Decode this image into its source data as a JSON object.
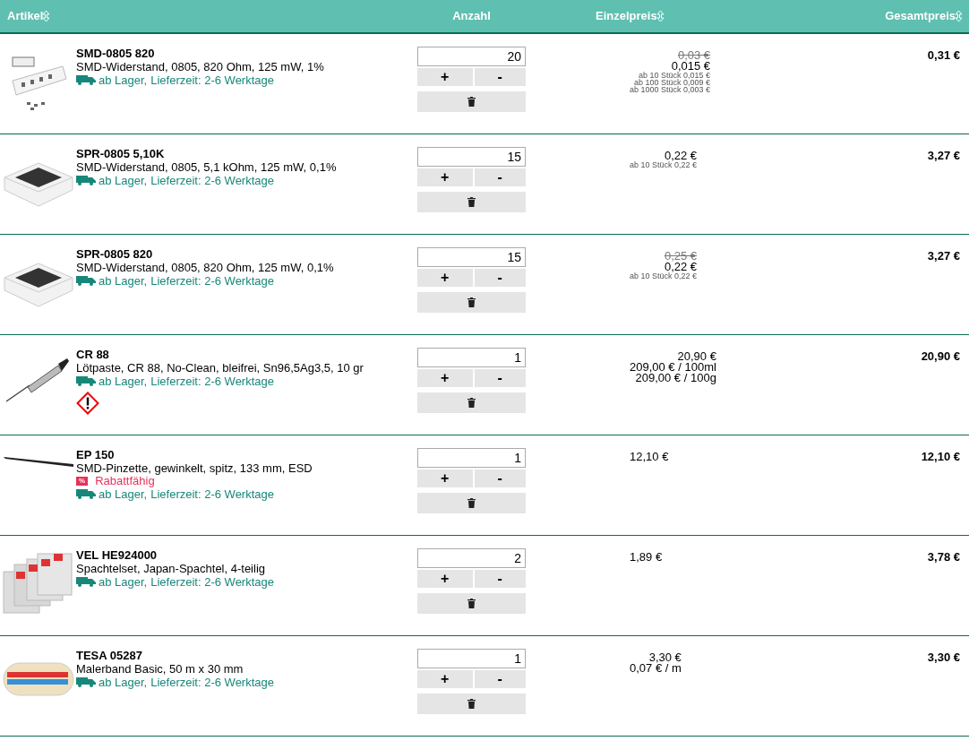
{
  "header": [
    {
      "label": "Artikel",
      "sortable": true
    },
    {
      "label": "Anzahl",
      "sortable": false
    },
    {
      "label": "Einzelpreis",
      "sortable": true
    },
    {
      "label": "Gesamtpreis",
      "sortable": true
    }
  ],
  "rows": [
    {
      "code": "SMD-0805 820",
      "description": "SMD-Widerstand, 0805, 820 Ohm, 125 mW, 1%",
      "hazard": false,
      "discount": null,
      "stock": "ab Lager,",
      "delivery": "Lieferzeit: 2-6 Werktage",
      "quantity": "20",
      "plus": "+",
      "minus": "-",
      "prices": [
        {
          "kind": "old",
          "text": "0,03 €"
        },
        {
          "kind": "main",
          "text": "0,015 €"
        },
        {
          "kind": "tier",
          "text": "ab 10 Stück 0,015 €"
        },
        {
          "kind": "tier",
          "text": "ab 100 Stück 0,009 €"
        },
        {
          "kind": "tier",
          "text": "ab 1000 Stück 0,003 €"
        }
      ],
      "total": "0,31 €"
    },
    {
      "code": "SPR-0805 5,10K",
      "description": "SMD-Widerstand, 0805, 5,1 kOhm, 125 mW, 0,1%",
      "hazard": false,
      "discount": null,
      "stock": "ab Lager,",
      "delivery": "Lieferzeit: 2-6 Werktage",
      "quantity": "15",
      "plus": "+",
      "minus": "-",
      "prices": [
        {
          "kind": "main",
          "text": "0,22 €"
        },
        {
          "kind": "tier",
          "text": "ab 10 Stück 0,22 €"
        }
      ],
      "total": "3,27 €"
    },
    {
      "code": "SPR-0805 820",
      "description": "SMD-Widerstand, 0805, 820 Ohm, 125 mW, 0,1%",
      "hazard": false,
      "discount": null,
      "stock": "ab Lager,",
      "delivery": "Lieferzeit: 2-6 Werktage",
      "quantity": "15",
      "plus": "+",
      "minus": "-",
      "prices": [
        {
          "kind": "old",
          "text": "0,25 €"
        },
        {
          "kind": "main",
          "text": "0,22 €"
        },
        {
          "kind": "tier",
          "text": "ab 10 Stück 0,22 €"
        }
      ],
      "total": "3,27 €"
    },
    {
      "code": "CR 88",
      "description": "Lötpaste, CR 88, No-Clean, bleifrei, Sn96,5Ag3,5, 10 gr",
      "hazard": true,
      "discount": null,
      "stock": "ab Lager,",
      "delivery": "Lieferzeit: 2-6 Werktage",
      "quantity": "1",
      "plus": "+",
      "minus": "-",
      "prices": [
        {
          "kind": "main",
          "text": "20,90 €"
        },
        {
          "kind": "main",
          "text": "209,00 € / 100ml"
        },
        {
          "kind": "main",
          "text": "209,00 € / 100g"
        }
      ],
      "total": "20,90 €"
    },
    {
      "code": "EP 150",
      "description": "SMD-Pinzette, gewinkelt, spitz, 133 mm, ESD",
      "hazard": false,
      "discount": {
        "icon": "%",
        "label": "Rabattfähig"
      },
      "stock": "ab Lager,",
      "delivery": "Lieferzeit: 2-6 Werktage",
      "quantity": "1",
      "plus": "+",
      "minus": "-",
      "prices": [
        {
          "kind": "main",
          "text": "12,10 €"
        }
      ],
      "total": "12,10 €"
    },
    {
      "code": "VEL HE924000",
      "description": "Spachtelset, Japan-Spachtel, 4-teilig",
      "hazard": false,
      "discount": null,
      "stock": "ab Lager,",
      "delivery": "Lieferzeit: 2-6 Werktage",
      "quantity": "2",
      "plus": "+",
      "minus": "-",
      "prices": [
        {
          "kind": "main",
          "text": "1,89 €"
        }
      ],
      "total": "3,78 €"
    },
    {
      "code": "TESA 05287",
      "description": "Malerband Basic, 50 m x 30 mm",
      "hazard": false,
      "discount": null,
      "stock": "ab Lager,",
      "delivery": "Lieferzeit: 2-6 Werktage",
      "quantity": "1",
      "plus": "+",
      "minus": "-",
      "prices": [
        {
          "kind": "main",
          "text": "3,30 €"
        },
        {
          "kind": "main",
          "text": "0,07 € / m"
        }
      ],
      "total": "3,30 €"
    }
  ]
}
